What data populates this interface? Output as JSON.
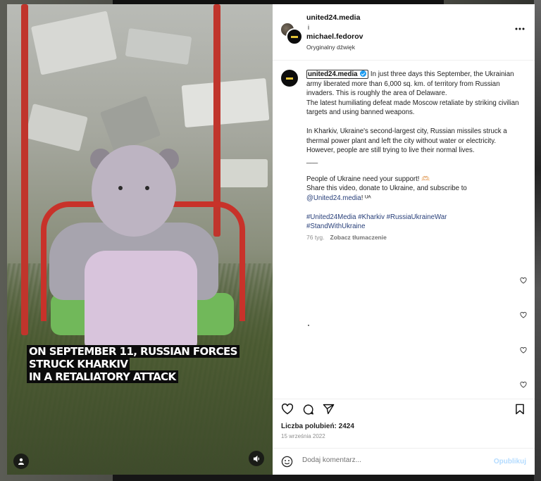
{
  "post": {
    "author": "united24.media",
    "collab_separator": "i",
    "coauthor": "michael.fedorov",
    "audio": "Oryginalny dźwięk"
  },
  "caption": {
    "username": "united24.media",
    "text": " In just three days this September, the Ukrainian army liberated more than 6,000 sq. km. of territory from Russian invaders. This is roughly the area of Delaware.\nThe latest humiliating defeat made Moscow retaliate by striking civilian targets and using banned weapons.\n\nIn Kharkiv, Ukraine's second-largest city, Russian missiles struck a thermal power plant and left the city without water or electricity. However, people are still trying to live their normal lives.\n___\n\nPeople of Ukraine need your support! 🫶🏻\nShare this video, donate to Ukraine, and subscribe to\n",
    "mention": "@United24.media",
    "mention_suffix": "! ᵁᴬ",
    "hashtags": "#United24Media #Kharkiv #RussiaUkraineWar\n#StandWithUkraine",
    "age": "76 tyg.",
    "translate": "Zobacz tłumaczenie"
  },
  "video_caption": [
    "ON SEPTEMBER 11, RUSSIAN FORCES",
    "STRUCK KHARKIV",
    "IN A RETALIATORY ATTACK"
  ],
  "likes": "Liczba polubień: 2424",
  "date": "15 września 2022",
  "comment_box": {
    "placeholder": "Dodaj komentarz...",
    "publish": "Opublikuj"
  },
  "colors": {
    "link": "#29407a",
    "verified": "#1d9bf0",
    "publish_disabled": "#b3dbff"
  },
  "icons": [
    "more-icon",
    "verified-icon",
    "heart-icon",
    "comment-icon",
    "share-icon",
    "bookmark-icon",
    "emoji-icon",
    "user-tag-icon",
    "sound-icon"
  ]
}
